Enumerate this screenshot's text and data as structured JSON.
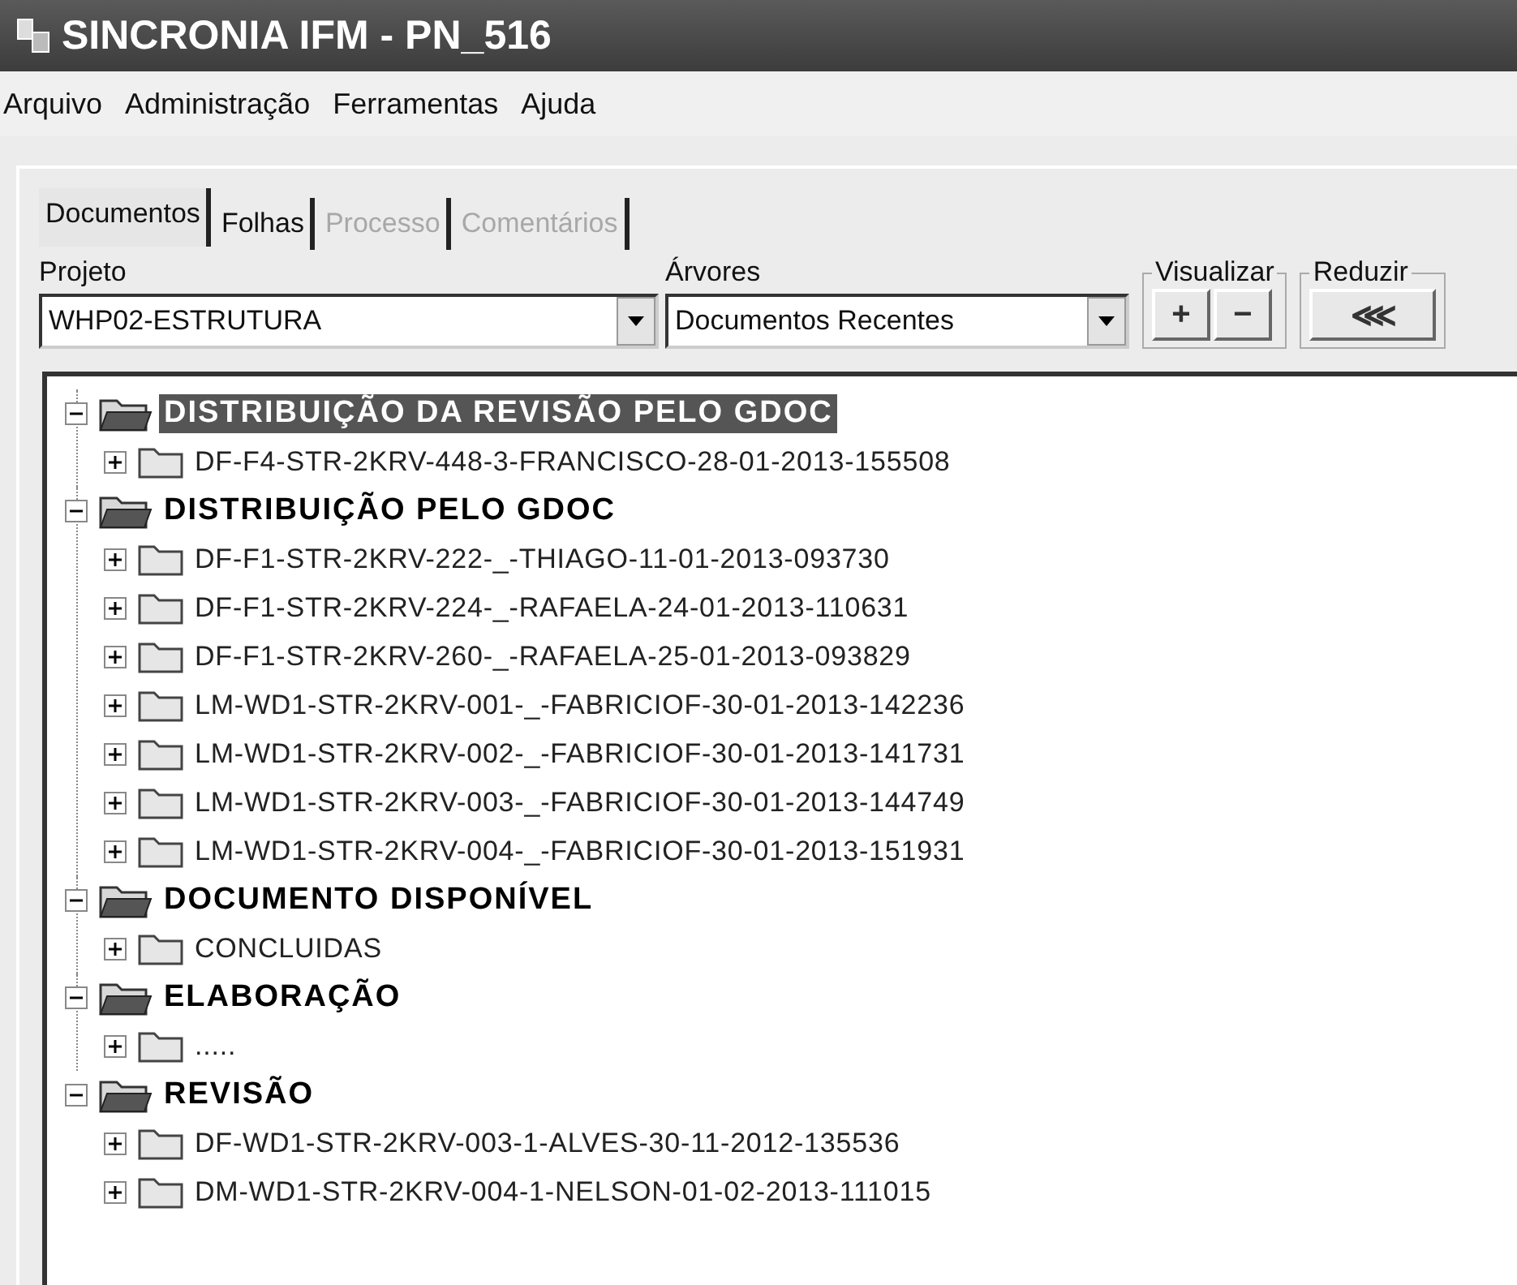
{
  "window": {
    "title": "SINCRONIA IFM - PN_516"
  },
  "menu": [
    "Arquivo",
    "Administração",
    "Ferramentas",
    "Ajuda"
  ],
  "tabs": [
    {
      "label": "Documentos",
      "selected": true,
      "disabled": false
    },
    {
      "label": "Folhas",
      "selected": false,
      "disabled": false
    },
    {
      "label": "Processo",
      "selected": false,
      "disabled": true
    },
    {
      "label": "Comentários",
      "selected": false,
      "disabled": true
    }
  ],
  "projeto": {
    "label": "Projeto",
    "value": "WHP02-ESTRUTURA"
  },
  "arvores": {
    "label": "Árvores",
    "value": "Documentos Recentes"
  },
  "visualizar": {
    "label": "Visualizar",
    "buttons": [
      "+",
      "−"
    ]
  },
  "reduzir": {
    "label": "Reduzir",
    "button": "⋘"
  },
  "tree": [
    {
      "label": "DISTRIBUIÇÃO DA REVISÃO PELO GDOC",
      "selected": true,
      "expanded": true,
      "children": [
        {
          "label": "DF-F4-STR-2KRV-448-3-FRANCISCO-28-01-2013-155508",
          "expanded": false
        }
      ]
    },
    {
      "label": "DISTRIBUIÇÃO PELO GDOC",
      "selected": false,
      "expanded": true,
      "children": [
        {
          "label": "DF-F1-STR-2KRV-222-_-THIAGO-11-01-2013-093730",
          "expanded": false
        },
        {
          "label": "DF-F1-STR-2KRV-224-_-RAFAELA-24-01-2013-110631",
          "expanded": false
        },
        {
          "label": "DF-F1-STR-2KRV-260-_-RAFAELA-25-01-2013-093829",
          "expanded": false
        },
        {
          "label": "LM-WD1-STR-2KRV-001-_-FABRICIOF-30-01-2013-142236",
          "expanded": false
        },
        {
          "label": "LM-WD1-STR-2KRV-002-_-FABRICIOF-30-01-2013-141731",
          "expanded": false
        },
        {
          "label": "LM-WD1-STR-2KRV-003-_-FABRICIOF-30-01-2013-144749",
          "expanded": false
        },
        {
          "label": "LM-WD1-STR-2KRV-004-_-FABRICIOF-30-01-2013-151931",
          "expanded": false
        }
      ]
    },
    {
      "label": "DOCUMENTO DISPONÍVEL",
      "selected": false,
      "expanded": true,
      "children": [
        {
          "label": "CONCLUIDAS",
          "expanded": false
        }
      ]
    },
    {
      "label": "ELABORAÇÃO",
      "selected": false,
      "expanded": true,
      "children": [
        {
          "label": ".....",
          "expanded": false
        }
      ]
    },
    {
      "label": "REVISÃO",
      "selected": false,
      "expanded": true,
      "children": [
        {
          "label": "DF-WD1-STR-2KRV-003-1-ALVES-30-11-2012-135536",
          "expanded": false
        },
        {
          "label": "DM-WD1-STR-2KRV-004-1-NELSON-01-02-2013-111015",
          "expanded": false
        }
      ]
    }
  ]
}
